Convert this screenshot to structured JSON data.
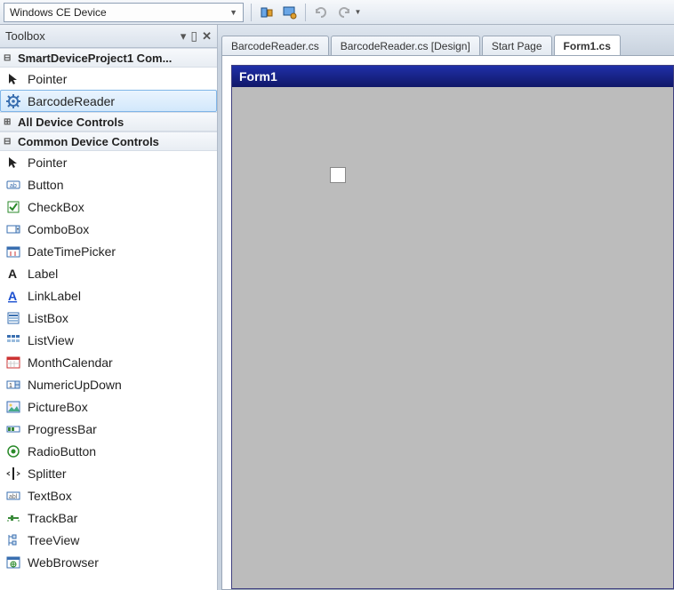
{
  "topbar": {
    "device_combo": "Windows CE Device"
  },
  "toolbox": {
    "title": "Toolbox",
    "groups": [
      {
        "id": "smartdevice",
        "label": "SmartDeviceProject1 Com...",
        "expanded": true,
        "items": [
          {
            "id": "pointer1",
            "label": "Pointer",
            "icon": "pointer"
          },
          {
            "id": "barcodereader",
            "label": "BarcodeReader",
            "icon": "gear",
            "selected": true
          }
        ]
      },
      {
        "id": "alldevice",
        "label": "All Device Controls",
        "expanded": false,
        "items": []
      },
      {
        "id": "commondevice",
        "label": "Common Device Controls",
        "expanded": true,
        "items": [
          {
            "id": "pointer2",
            "label": "Pointer",
            "icon": "pointer"
          },
          {
            "id": "button",
            "label": "Button",
            "icon": "button"
          },
          {
            "id": "checkbox",
            "label": "CheckBox",
            "icon": "checkbox"
          },
          {
            "id": "combobox",
            "label": "ComboBox",
            "icon": "combobox"
          },
          {
            "id": "datetimepicker",
            "label": "DateTimePicker",
            "icon": "datetime"
          },
          {
            "id": "label",
            "label": "Label",
            "icon": "label"
          },
          {
            "id": "linklabel",
            "label": "LinkLabel",
            "icon": "linklabel"
          },
          {
            "id": "listbox",
            "label": "ListBox",
            "icon": "listbox"
          },
          {
            "id": "listview",
            "label": "ListView",
            "icon": "listview"
          },
          {
            "id": "monthcalendar",
            "label": "MonthCalendar",
            "icon": "calendar"
          },
          {
            "id": "numericupdown",
            "label": "NumericUpDown",
            "icon": "numeric"
          },
          {
            "id": "picturebox",
            "label": "PictureBox",
            "icon": "picture"
          },
          {
            "id": "progressbar",
            "label": "ProgressBar",
            "icon": "progress"
          },
          {
            "id": "radiobutton",
            "label": "RadioButton",
            "icon": "radio"
          },
          {
            "id": "splitter",
            "label": "Splitter",
            "icon": "splitter"
          },
          {
            "id": "textbox",
            "label": "TextBox",
            "icon": "textbox"
          },
          {
            "id": "trackbar",
            "label": "TrackBar",
            "icon": "trackbar"
          },
          {
            "id": "treeview",
            "label": "TreeView",
            "icon": "treeview"
          },
          {
            "id": "webbrowser",
            "label": "WebBrowser",
            "icon": "web"
          }
        ]
      }
    ]
  },
  "tabs": [
    {
      "label": "BarcodeReader.cs",
      "active": false
    },
    {
      "label": "BarcodeReader.cs [Design]",
      "active": false
    },
    {
      "label": "Start Page",
      "active": false
    },
    {
      "label": "Form1.cs",
      "active": true
    }
  ],
  "form": {
    "title": "Form1"
  }
}
